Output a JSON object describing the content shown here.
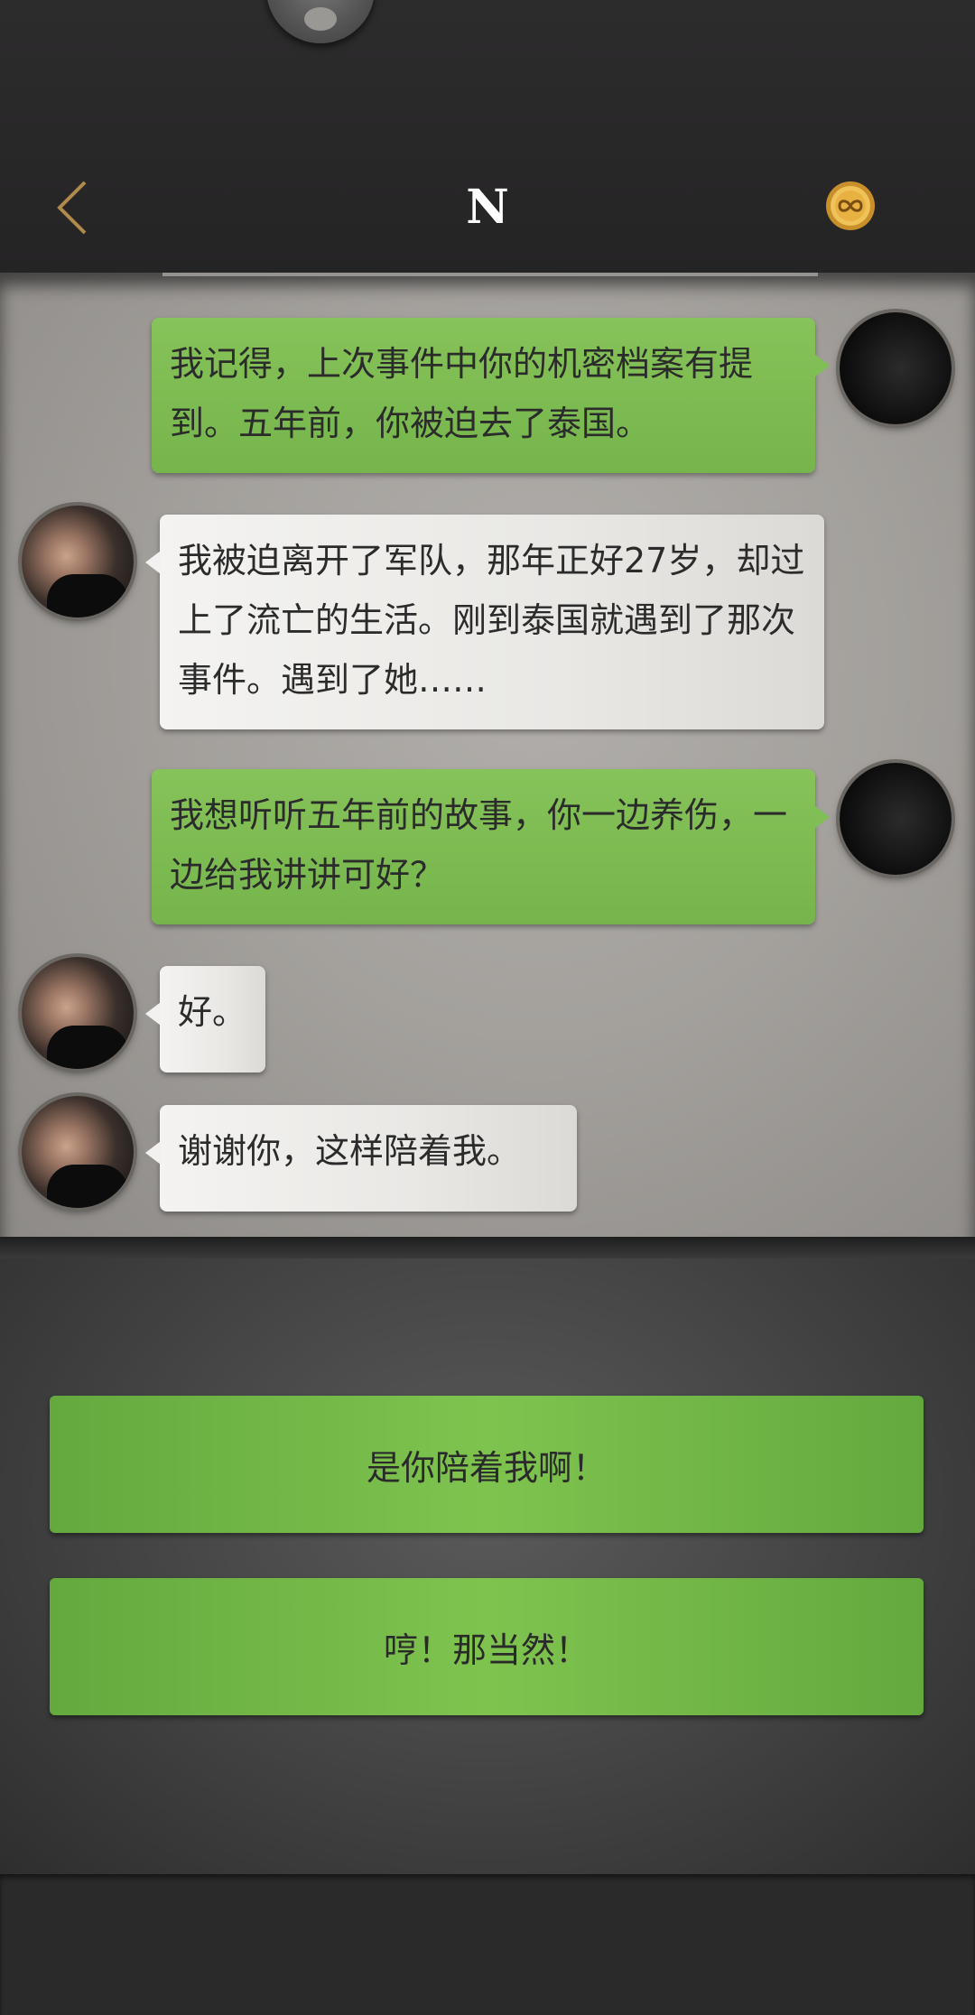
{
  "header": {
    "title": "N",
    "back_icon": "chevron-left-icon",
    "coin_icon": "infinity-coin-icon"
  },
  "messages": [
    {
      "sender": "self",
      "text": "我记得，上次事件中你的机密档案有提到。五年前，你被迫去了泰国。"
    },
    {
      "sender": "other",
      "text": "我被迫离开了军队，那年正好27岁，却过上了流亡的生活。刚到泰国就遇到了那次事件。遇到了她……"
    },
    {
      "sender": "self",
      "text": "我想听听五年前的故事，你一边养伤，一边给我讲讲可好？"
    },
    {
      "sender": "other",
      "text": "好。"
    },
    {
      "sender": "other",
      "text": "谢谢你，这样陪着我。"
    }
  ],
  "choices": [
    {
      "label": "是你陪着我啊！"
    },
    {
      "label": "哼！那当然！"
    }
  ],
  "colors": {
    "self_bubble": "#7dbd52",
    "other_bubble": "#efeeeb",
    "choice_button": "#74b846",
    "header_bg": "#2a292a"
  }
}
